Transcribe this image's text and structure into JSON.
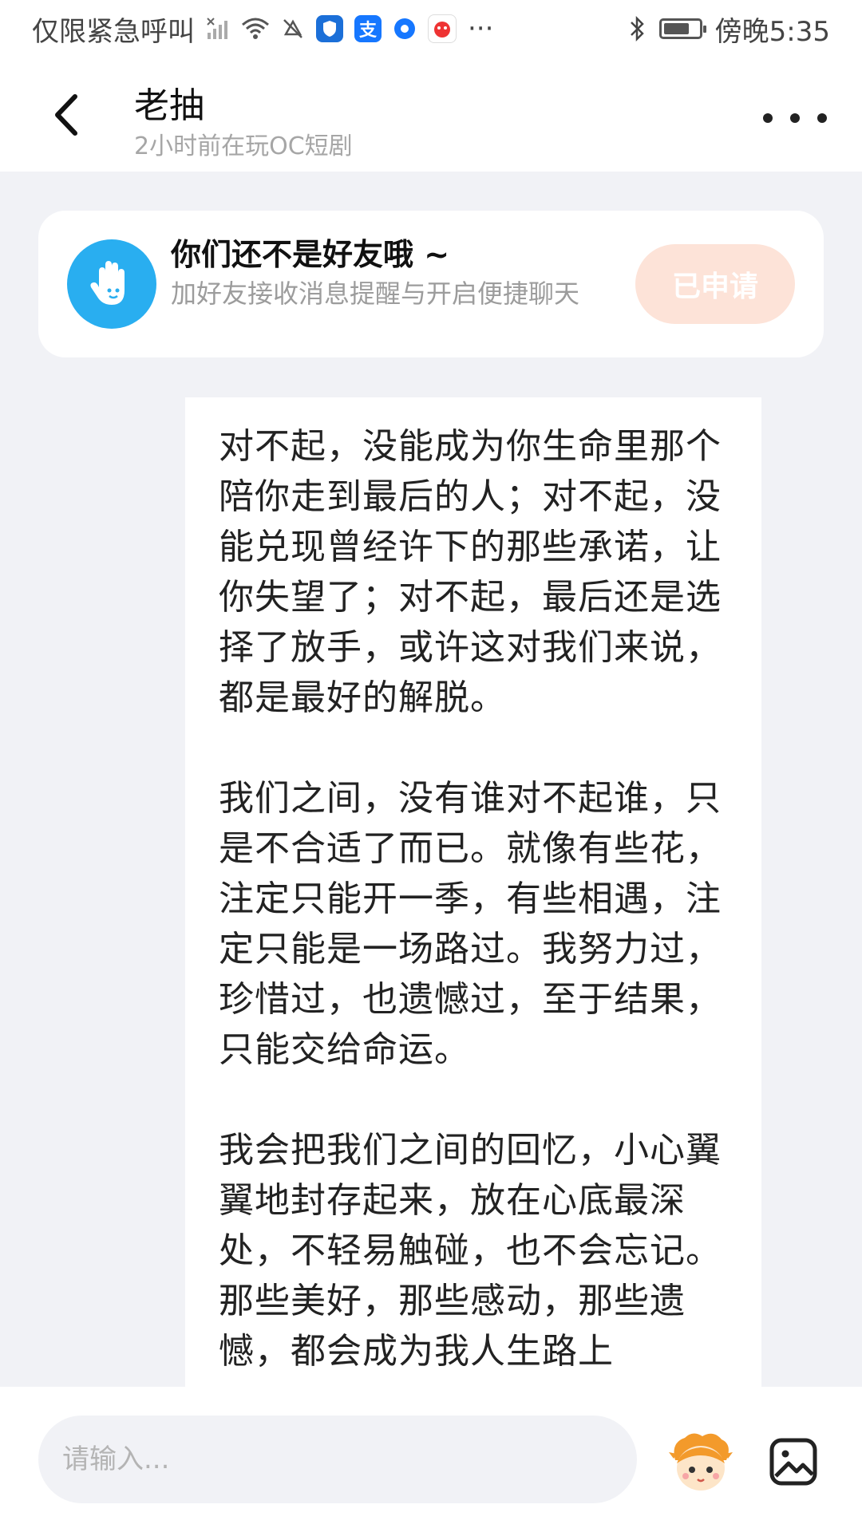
{
  "status_bar": {
    "carrier": "仅限紧急呼叫",
    "more": "···",
    "time": "傍晚5:35",
    "alipay_glyph": "支",
    "battery_level": 0.75
  },
  "header": {
    "title": "老抽",
    "subtitle": "2小时前在玩OC短剧"
  },
  "friend_card": {
    "title": "你们还不是好友哦 ~",
    "description": "加好友接收消息提醒与开启便捷聊天",
    "button_label": "已申请"
  },
  "message": {
    "text": "对不起，没能成为你生命里那个陪你走到最后的人；对不起，没能兑现曾经许下的那些承诺，让你失望了；对不起，最后还是选择了放手，或许这对我们来说，都是最好的解脱。\n\n我们之间，没有谁对不起谁，只是不合适了而已。就像有些花，注定只能开一季，有些相遇，注定只能是一场路过。我努力过，珍惜过，也遗憾过，至于结果，只能交给命运。\n\n我会把我们之间的回忆，小心翼翼地封存起来，放在心底最深处，不轻易触碰，也不会忘记。那些美好，那些感动，那些遗憾，都会成为我人生路上"
  },
  "input_bar": {
    "placeholder": "请输入..."
  },
  "colors": {
    "page_bg": "#f1f2f6",
    "avatar_blue": "#29aef0",
    "applied_button_bg": "#fde3d8"
  }
}
